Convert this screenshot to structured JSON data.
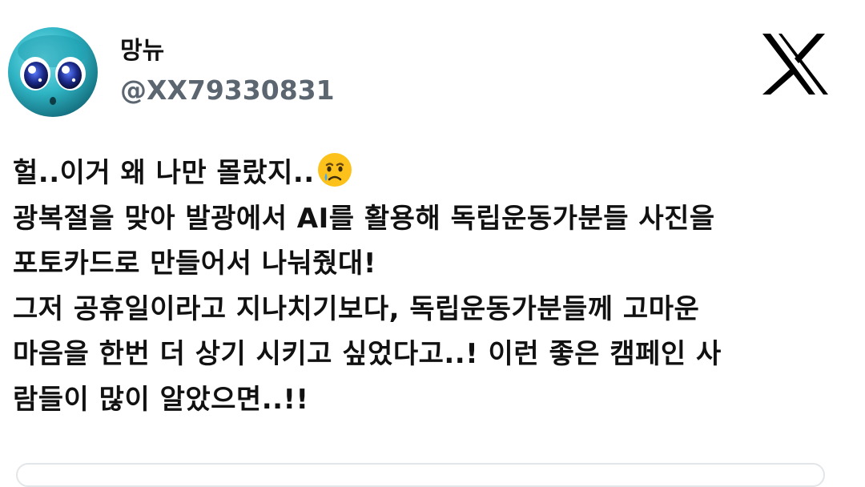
{
  "tweet": {
    "author": {
      "display_name": "망뉴",
      "handle": "@XX79330831",
      "avatar": "blue-cartoon-face-avatar"
    },
    "platform_icon": "x-logo-icon",
    "text": {
      "line1": "헐..이거 왜 나만 몰랐지..",
      "line1_emoji": "crying-face-emoji",
      "line2": "광복절을 맞아 발광에서 AI를 활용해 독립운동가분들 사진을",
      "line3": "포토카드로 만들어서 나눠줬대!",
      "line4": "그저 공휴일이라고 지나치기보다, 독립운동가분들께 고마운",
      "line5": "마음을 한번 더 상기 시키고 싶었다고..! 이런 좋은 캠페인 사",
      "line6": "람들이 많이 알았으면..!!"
    }
  },
  "colors": {
    "text": "#111111",
    "handle": "#5b6670",
    "avatar_base": "#2fb4c4",
    "divider": "#e3e6e8"
  }
}
